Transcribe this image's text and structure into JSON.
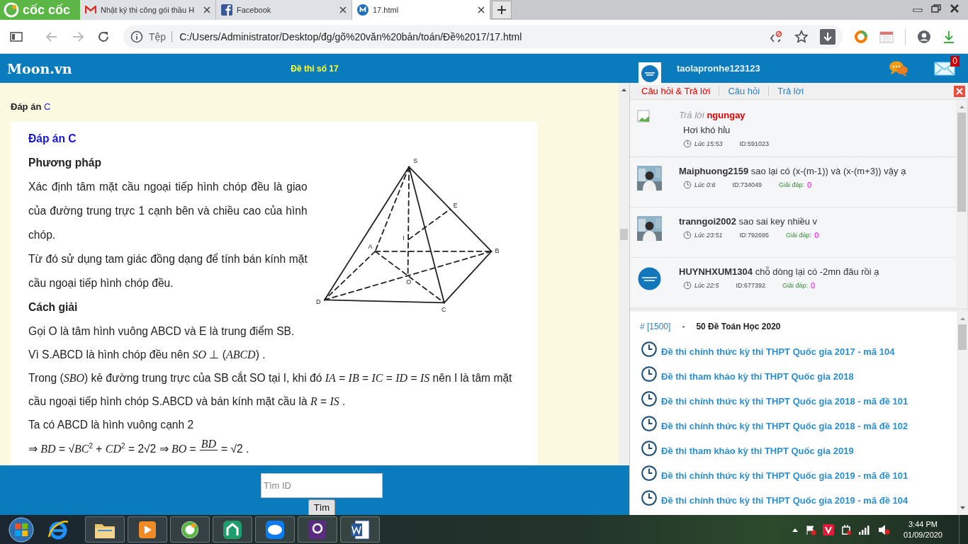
{
  "browser": {
    "brand": "cốc cốc",
    "tabs": [
      {
        "title": "Nhật ký thi công gói thầu H",
        "selected": false
      },
      {
        "title": "Facebook",
        "selected": false
      },
      {
        "title": "17.html",
        "selected": true
      }
    ],
    "scheme": "Tệp",
    "url": "C:/Users/Administrator/Desktop/đg/gõ%20văn%20bản/toán/Đề%2017/17.html"
  },
  "site": {
    "logo": "Moon.vn",
    "title": "Đề thi số 17",
    "username": "taolapronhe123123",
    "mail_count": "0"
  },
  "answer": {
    "label": "Đáp án",
    "letter": "C"
  },
  "solution": {
    "blocks": [
      {
        "kind": "title",
        "text": "Đáp án C"
      },
      {
        "kind": "heading",
        "text": "Phương pháp"
      },
      {
        "kind": "para",
        "text": "Xác định tâm mặt cầu ngoại tiếp hình chóp đều là giao của đường trung trực 1 cạnh bên và chiều cao của hình chóp."
      },
      {
        "kind": "para",
        "text": "Từ đó sử dụng tam giác đồng dạng để tính bán kính mặt cầu ngoại tiếp hình chóp đều."
      },
      {
        "kind": "heading",
        "text": "Cách giải"
      },
      {
        "kind": "para",
        "text": "Gọi O là tâm hình vuông ABCD và E là trung điểm SB."
      },
      {
        "kind": "para",
        "text": "Vì S.ABCD là hình chóp đều nên *SO* ⊥ (*ABCD*) ."
      },
      {
        "kind": "para",
        "text": "Trong (*SBO*) kẻ đường trung trực của SB cắt SO tại I, khi đó *IA* = *IB* = *IC* = *ID* = *IS* nên I là tâm mặt cầu ngoại tiếp hình chóp S.ABCD và bán kính mặt cầu là *R* = *IS* ."
      },
      {
        "kind": "para",
        "text": "Ta có ABCD là hình vuông cạnh 2"
      },
      {
        "kind": "formula",
        "before": "⇒ *BD* = √*BC*$^{2}$ + *CD*$^{2}$ = 2√2 ⇒ *BO* =",
        "numerator": "*BD*",
        "after": "= √2 ."
      }
    ],
    "figure_labels": [
      "S",
      "E",
      "A",
      "I",
      "B",
      "O",
      "D",
      "C"
    ]
  },
  "qa": {
    "tabs": [
      {
        "label": "Câu hỏi & Trả lời",
        "selected": true
      },
      {
        "label": "Câu hỏi",
        "selected": false
      },
      {
        "label": "Trả lời",
        "selected": false
      }
    ],
    "comments": [
      {
        "kind": "reply",
        "action": "Trả lời",
        "user": "ngungay",
        "text": "Hơi khó hỉu",
        "time": "Lúc 15:53",
        "id": "ID:591023"
      },
      {
        "kind": "question",
        "user": "Maiphuong2159",
        "text": "sao lại có (x-(m-1)) và (x-(m+3)) vậy ạ",
        "time": "Lúc 0:6",
        "id": "ID:734049",
        "answers_label": "Giải đáp:",
        "answers": "0"
      },
      {
        "kind": "question",
        "user": "tranngoi2002",
        "text": "sao sai key nhiều v",
        "time": "Lúc 23:51",
        "id": "ID:792695",
        "answers_label": "Giải đáp:",
        "answers": "0"
      },
      {
        "kind": "question",
        "user": "HUYNHXUM1304",
        "text": "chỗ dòng lại có -2mn đâu rồi ạ",
        "time": "Lúc 22:5",
        "id": "ID:677392",
        "answers_label": "Giải đáp:",
        "answers": "0"
      }
    ]
  },
  "exams": {
    "code": "# [1500]",
    "separator": "-",
    "title": "50 Đề Toán Học 2020",
    "items": [
      "Đề thi chính thức kỳ thi THPT Quốc gia 2017 - mã 104",
      "Đề thi tham khảo kỳ thi THPT Quốc gia 2018",
      "Đề thi chính thức kỳ thi THPT Quốc gia 2018 - mã đề 101",
      "Đề thi chính thức kỳ thi THPT Quốc gia 2018 - mã đề 102",
      "Đề thi tham khảo kỳ thi THPT Quốc gia 2019",
      "Đề thi chính thức kỳ thi THPT Quốc gia 2019 - mã đề 101",
      "Đề thi chính thức kỳ thi THPT Quốc gia 2019 - mã đề 104"
    ]
  },
  "search": {
    "placeholder": "Tìm ID",
    "button": "Tìm"
  },
  "taskbar": {
    "time": "3:44 PM",
    "date": "01/09/2020"
  }
}
